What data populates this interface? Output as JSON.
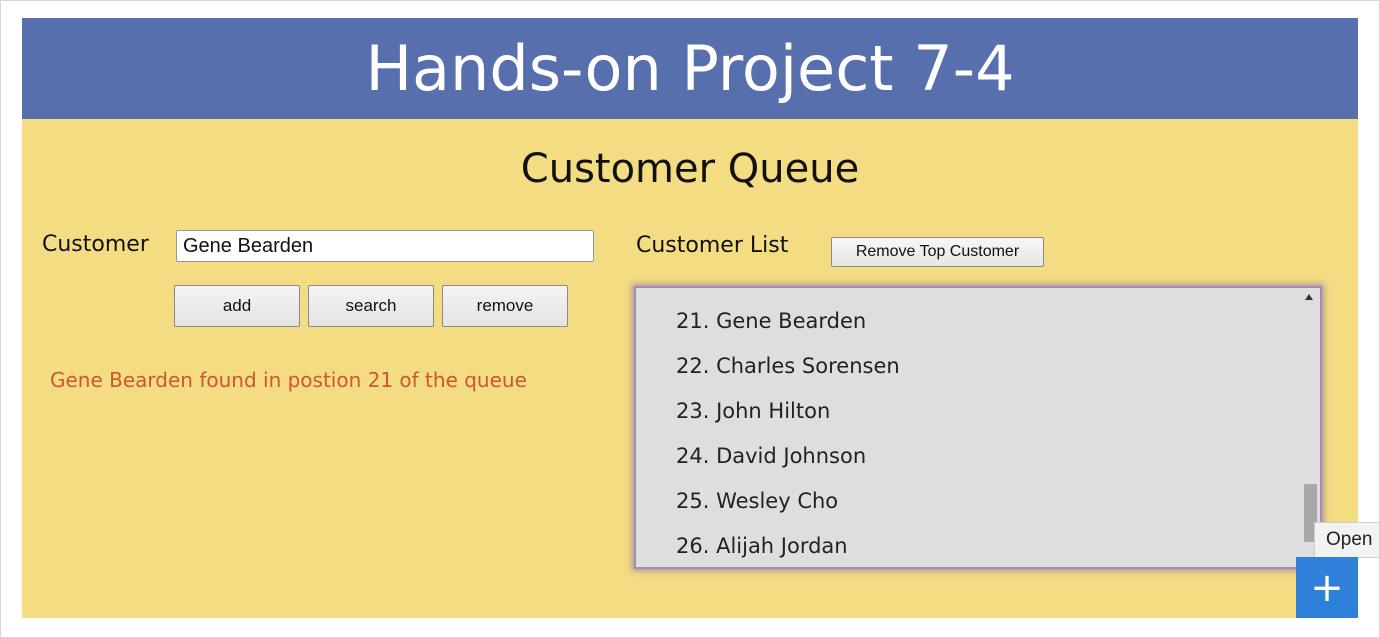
{
  "header": {
    "title": "Hands-on Project 7-4"
  },
  "subtitle": "Customer Queue",
  "customer_form": {
    "label": "Customer",
    "input_value": "Gene Bearden",
    "buttons": {
      "add": "add",
      "search": "search",
      "remove": "remove"
    },
    "message": "Gene Bearden found in postion 21 of the queue"
  },
  "customer_list": {
    "label": "Customer List",
    "remove_top_button": "Remove Top Customer",
    "items": [
      "21. Gene Bearden",
      "22. Charles Sorensen",
      "23. John Hilton",
      "24. David Johnson",
      "25. Wesley Cho",
      "26. Alijah Jordan"
    ]
  },
  "overlay": {
    "tooltip": "Open",
    "plus_button": "+"
  },
  "colors": {
    "banner": "#5770ad",
    "background": "#f3dc82",
    "message": "#d0562b",
    "list_border": "#a18cc0",
    "plus_button": "#2f80d8"
  },
  "icons": {
    "scroll_up": "triangle-up-icon",
    "plus": "plus-icon"
  }
}
